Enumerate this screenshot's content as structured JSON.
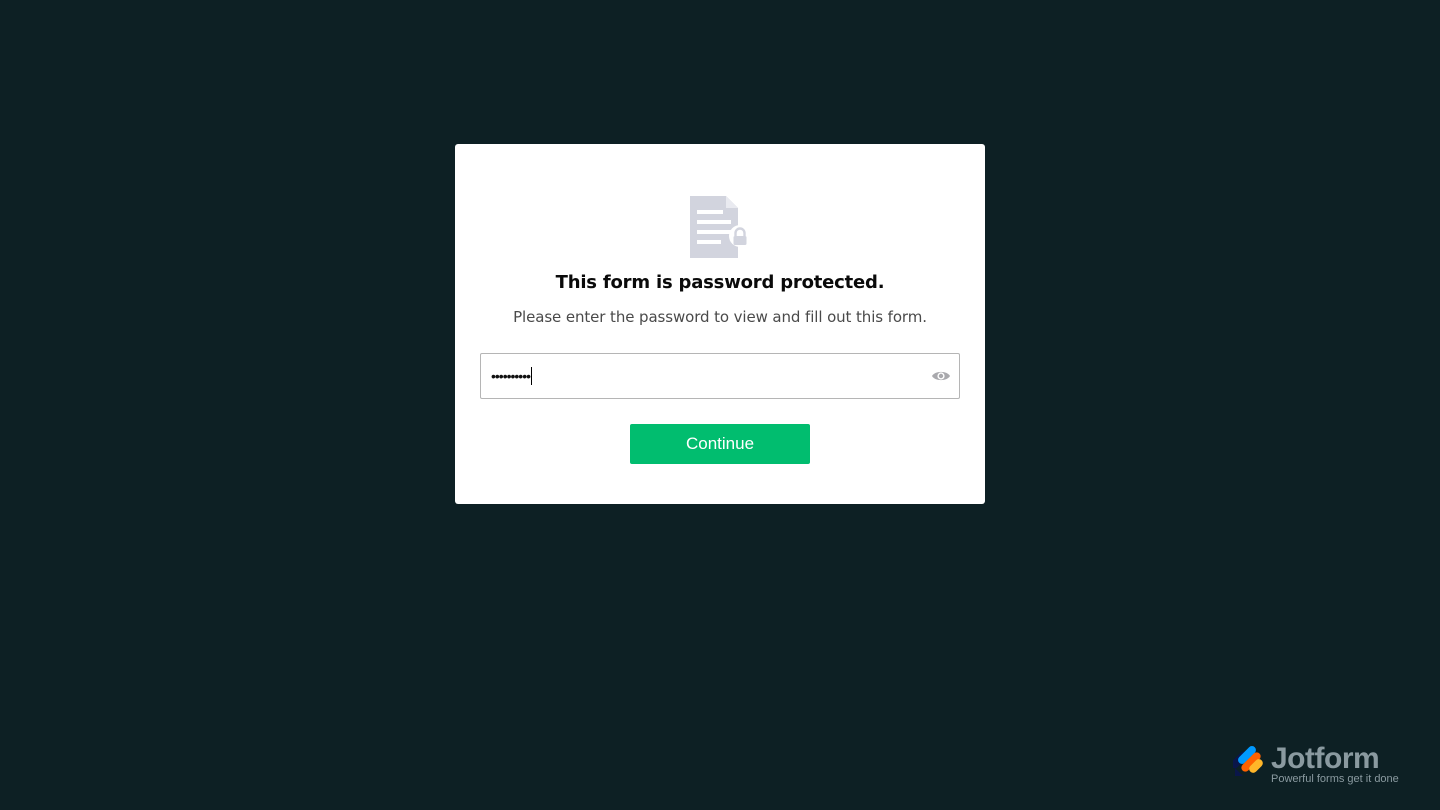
{
  "modal": {
    "icon": "document-lock-icon",
    "title": "This form is password protected.",
    "subtitle": "Please enter the password to view and fill out this form.",
    "password": {
      "masked_value": "••••••••••",
      "toggle_icon": "eye-icon"
    },
    "continue_label": "Continue"
  },
  "branding": {
    "name": "Jotform",
    "tagline": "Powerful forms get it done",
    "logo_icon": "jotform-logo-icon"
  },
  "colors": {
    "background": "#0d2024",
    "accent": "#01bd6f",
    "icon_gray": "#d1d3dd"
  }
}
